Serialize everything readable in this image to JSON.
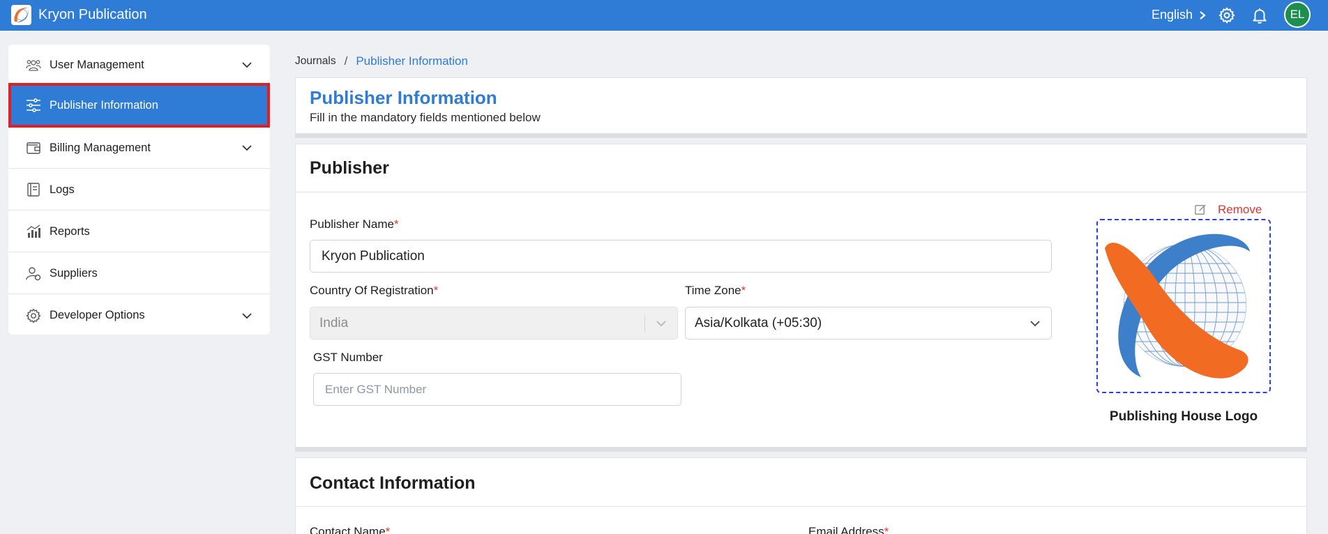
{
  "app": {
    "title": "Kryon Publication"
  },
  "topbar": {
    "language": "English",
    "avatar_initials": "EL",
    "icons": [
      "settings-gear-icon",
      "notification-bell-icon"
    ]
  },
  "sidebar": {
    "items": [
      {
        "label": "User Management",
        "icon": "users-icon",
        "expandable": true
      },
      {
        "label": "Publisher Information",
        "icon": "sliders-icon",
        "active": true
      },
      {
        "label": "Billing Management",
        "icon": "wallet-icon",
        "expandable": true
      },
      {
        "label": "Logs",
        "icon": "notebook-icon"
      },
      {
        "label": "Reports",
        "icon": "bar-chart-icon"
      },
      {
        "label": "Suppliers",
        "icon": "supplier-user-icon"
      },
      {
        "label": "Developer Options",
        "icon": "gear-icon",
        "expandable": true
      }
    ]
  },
  "breadcrumb": {
    "root": "Journals",
    "separator": "/",
    "current": "Publisher Information"
  },
  "header": {
    "title": "Publisher Information",
    "subtitle": "Fill in the mandatory fields mentioned below"
  },
  "publisher": {
    "section_title": "Publisher",
    "name": {
      "label": "Publisher Name",
      "required": "*",
      "value": "Kryon Publication"
    },
    "country": {
      "label": "Country Of Registration",
      "required": "*",
      "value": "India"
    },
    "timezone": {
      "label": "Time Zone",
      "required": "*",
      "value": "Asia/Kolkata (+05:30)"
    },
    "gst": {
      "label": "GST Number",
      "placeholder": "Enter GST Number"
    },
    "logo": {
      "caption": "Publishing House Logo",
      "remove_label": "Remove"
    }
  },
  "contact": {
    "section_title": "Contact Information",
    "contact_name": {
      "label": "Contact Name",
      "required": "*"
    },
    "email": {
      "label": "Email Address",
      "required": "*"
    }
  },
  "colors": {
    "primary": "#2f7cd6",
    "active_outline": "#e01e24",
    "required": "#e5342e",
    "logo_orange": "#f26b22",
    "logo_blue": "#3d7fc9"
  }
}
